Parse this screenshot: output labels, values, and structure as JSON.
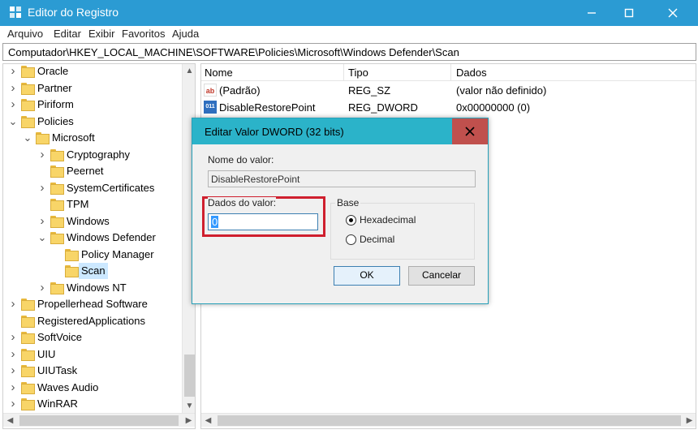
{
  "window": {
    "title": "Editor do Registro"
  },
  "menu": [
    "Arquivo",
    "Editar",
    "Exibir",
    "Favoritos",
    "Ajuda"
  ],
  "address": "Computador\\HKEY_LOCAL_MACHINE\\SOFTWARE\\Policies\\Microsoft\\Windows Defender\\Scan",
  "tree": [
    {
      "label": "Oracle",
      "expanded": false
    },
    {
      "label": "Partner",
      "expanded": false
    },
    {
      "label": "Piriform",
      "expanded": false
    },
    {
      "label": "Policies",
      "expanded": true
    },
    {
      "label": "Microsoft",
      "expanded": true
    },
    {
      "label": "Cryptography",
      "expanded": false
    },
    {
      "label": "Peernet",
      "expanded": null
    },
    {
      "label": "SystemCertificates",
      "expanded": false
    },
    {
      "label": "TPM",
      "expanded": null
    },
    {
      "label": "Windows",
      "expanded": false
    },
    {
      "label": "Windows Defender",
      "expanded": true
    },
    {
      "label": "Policy Manager",
      "expanded": null
    },
    {
      "label": "Scan",
      "expanded": null,
      "selected": true
    },
    {
      "label": "Windows NT",
      "expanded": false
    },
    {
      "label": "Propellerhead Software",
      "expanded": false
    },
    {
      "label": "RegisteredApplications",
      "expanded": null
    },
    {
      "label": "SoftVoice",
      "expanded": false
    },
    {
      "label": "UIU",
      "expanded": false
    },
    {
      "label": "UIUTask",
      "expanded": false
    },
    {
      "label": "Waves Audio",
      "expanded": false
    },
    {
      "label": "WinRAR",
      "expanded": false
    }
  ],
  "list": {
    "columns": [
      "Nome",
      "Tipo",
      "Dados"
    ],
    "rows": [
      {
        "icon": "string-value-icon",
        "icon_text": "ab",
        "name": "(Padrão)",
        "type": "REG_SZ",
        "data": "(valor não definido)"
      },
      {
        "icon": "dword-value-icon",
        "icon_text": "011\n110",
        "name": "DisableRestorePoint",
        "type": "REG_DWORD",
        "data": "0x00000000 (0)"
      }
    ]
  },
  "dialog": {
    "title": "Editar Valor DWORD (32 bits)",
    "value_name_label": "Nome do valor:",
    "value_name": "DisableRestorePoint",
    "value_data_label": "Dados do valor:",
    "value_data": "0",
    "base_label": "Base",
    "base_options": [
      "Hexadecimal",
      "Decimal"
    ],
    "base_selected": "Hexadecimal",
    "ok": "OK",
    "cancel": "Cancelar"
  },
  "colors": {
    "titlebar": "#2b9bd3",
    "dialog_title": "#2bb3c9",
    "close": "#c0504d",
    "highlight": "#cf1f2e"
  }
}
